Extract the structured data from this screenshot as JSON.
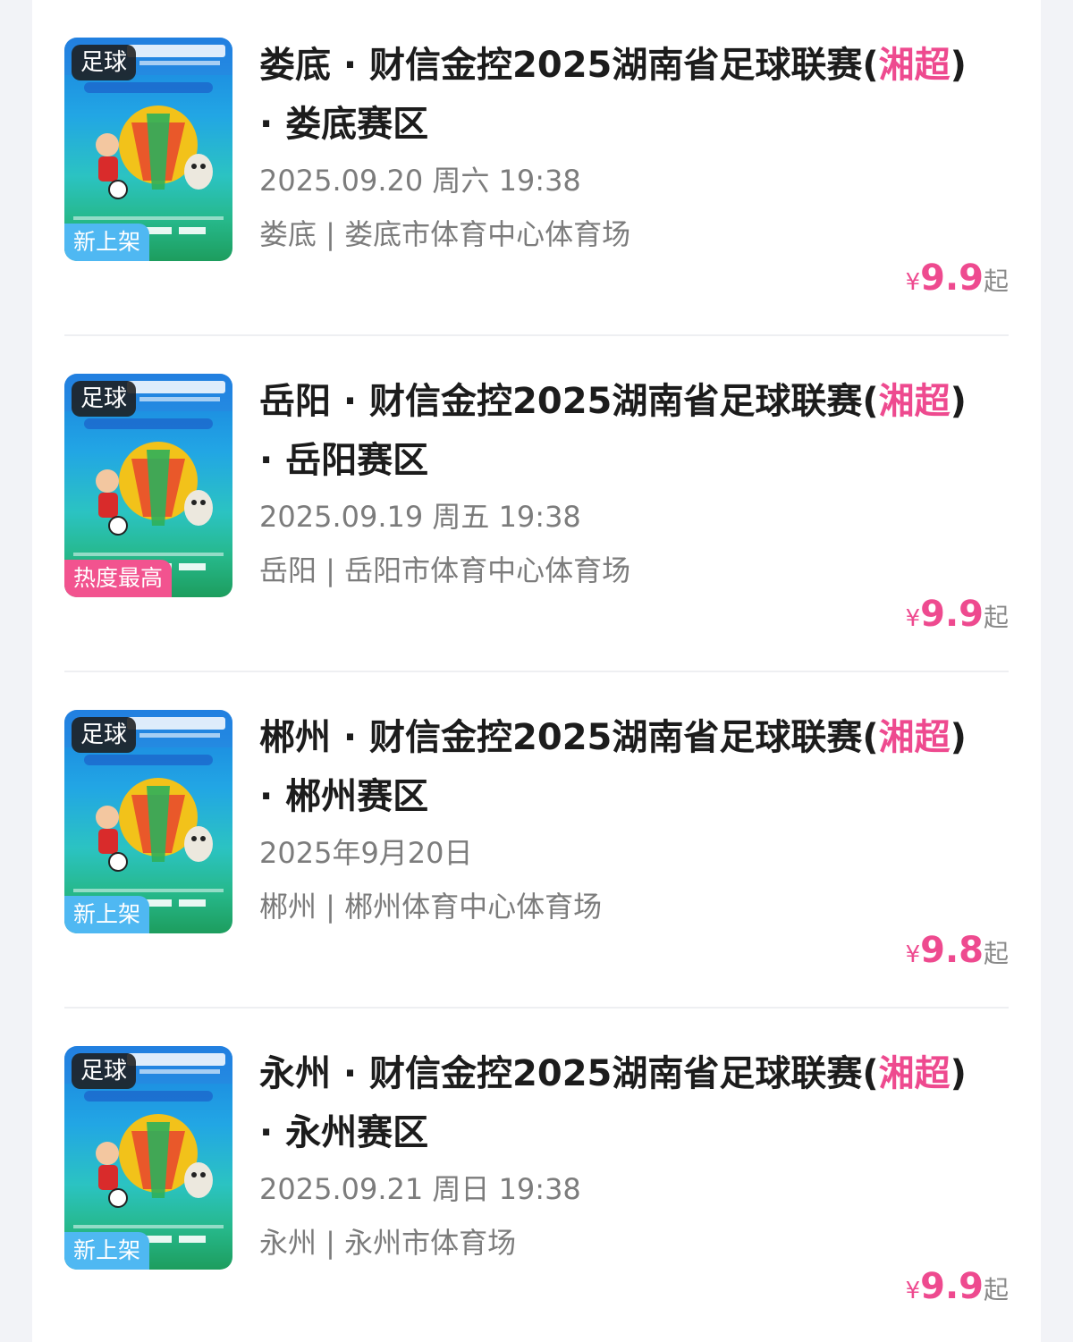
{
  "accent_color": "#ee4a8f",
  "events": [
    {
      "sport_tag": "足球",
      "badge": "新上架",
      "badge_type": "new",
      "poster_icon": "hunan-football-league-poster",
      "title_a": "娄底 · 财信金控2025湖南省足球联赛(",
      "title_hl": "湘超",
      "title_b": ") · 娄底赛区",
      "date": "2025.09.20 周六 19:38",
      "venue": "娄底 | 娄底市体育中心体育场",
      "currency": "¥",
      "price": "9.9",
      "price_suffix": "起"
    },
    {
      "sport_tag": "足球",
      "badge": "热度最高",
      "badge_type": "hot",
      "poster_icon": "hunan-football-league-poster",
      "title_a": "岳阳 · 财信金控2025湖南省足球联赛(",
      "title_hl": "湘超",
      "title_b": ") · 岳阳赛区",
      "date": "2025.09.19 周五 19:38",
      "venue": "岳阳 | 岳阳市体育中心体育场",
      "currency": "¥",
      "price": "9.9",
      "price_suffix": "起"
    },
    {
      "sport_tag": "足球",
      "badge": "新上架",
      "badge_type": "new",
      "poster_icon": "hunan-football-league-poster",
      "title_a": "郴州 · 财信金控2025湖南省足球联赛(",
      "title_hl": "湘超",
      "title_b": ") · 郴州赛区",
      "date": "2025年9月20日",
      "venue": "郴州 | 郴州体育中心体育场",
      "currency": "¥",
      "price": "9.8",
      "price_suffix": "起"
    },
    {
      "sport_tag": "足球",
      "badge": "新上架",
      "badge_type": "new",
      "poster_icon": "hunan-football-league-poster",
      "title_a": "永州 · 财信金控2025湖南省足球联赛(",
      "title_hl": "湘超",
      "title_b": ") · 永州赛区",
      "date": "2025.09.21 周日 19:38",
      "venue": "永州 | 永州市体育场",
      "currency": "¥",
      "price": "9.9",
      "price_suffix": "起"
    }
  ]
}
